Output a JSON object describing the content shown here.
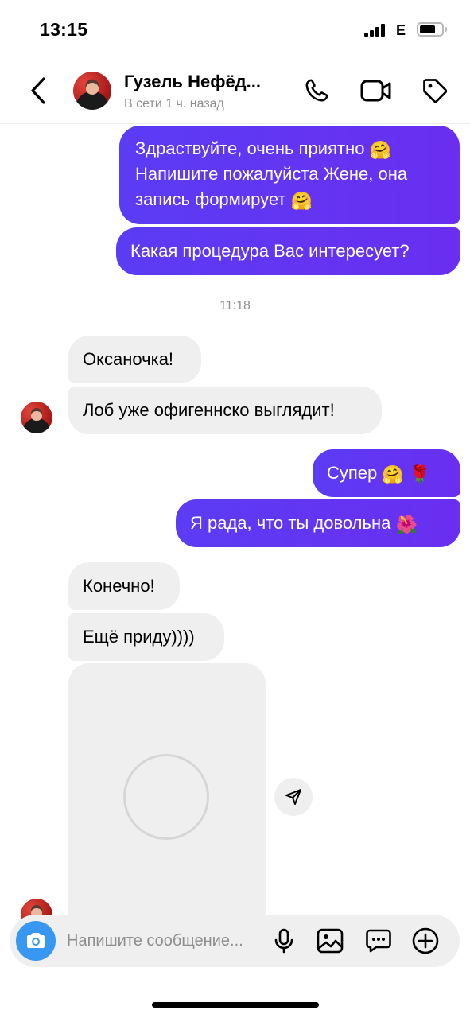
{
  "status_bar": {
    "time": "13:15",
    "network": "E"
  },
  "header": {
    "contact_name": "Гузель Нефёд...",
    "contact_status": "В сети 1 ч. назад",
    "icons": [
      "back-arrow-icon",
      "phone-icon",
      "video-camera-icon",
      "tag-icon"
    ]
  },
  "messages": {
    "out_1_line_1": "Здраствуйте, очень приятно",
    "out_1_line_2": "Напишите пожалуйста Жене, она",
    "out_1_line_3": "запись формирует",
    "out_2": "Какая процедура Вас интересует?",
    "timestamp": "11:18",
    "in_1": "Оксаночка!",
    "in_2": "Лоб уже офигеннско выглядит!",
    "out_3": "Супер",
    "out_4": "Я рада, что ты довольна",
    "in_3": "Конечно!",
    "in_4": "Ещё приду))))"
  },
  "emoji": {
    "hug": "🤗",
    "rose": "🌹",
    "hibiscus": "🌺"
  },
  "composer": {
    "placeholder": "Напишите сообщение...",
    "icons": [
      "camera-icon",
      "microphone-icon",
      "gallery-icon",
      "sticker-chat-icon",
      "plus-icon"
    ]
  },
  "colors": {
    "outgoing_bubble": "#5b3cf5",
    "incoming_bubble": "#efefef",
    "camera_button": "#3897f0"
  }
}
